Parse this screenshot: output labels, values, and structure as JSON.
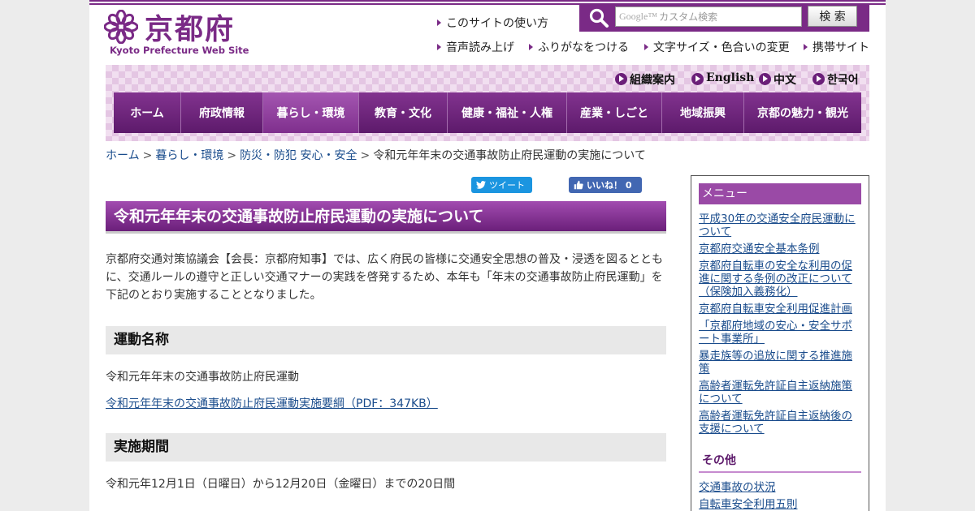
{
  "header": {
    "logo_name": "京都府",
    "logo_sub": "Kyoto Prefecture Web Site",
    "search_placeholder": "カスタム検索",
    "search_google": "Google™",
    "search_button": "検 索",
    "util_links": [
      "このサイトの使い方",
      "音声読み上げ",
      "ふりがなをつける",
      "文字サイズ・色合いの変更",
      "携帯サイト"
    ]
  },
  "languages": [
    "組織案内",
    "English",
    "中文",
    "한국어"
  ],
  "global_nav": {
    "items": [
      "ホーム",
      "府政情報",
      "暮らし・環境",
      "教育・文化",
      "健康・福祉・人権",
      "産業・しごと",
      "地域振興",
      "京都の魅力・観光"
    ],
    "active_index": 2
  },
  "breadcrumb": {
    "items": [
      "ホーム",
      "暮らし・環境",
      "防災・防犯 安心・安全"
    ],
    "current": "令和元年年末の交通事故防止府民運動の実施について",
    "separator": ">"
  },
  "social": {
    "tweet": "ツイート",
    "like": "いいね！ 0"
  },
  "main": {
    "title": "令和元年年末の交通事故防止府民運動の実施について",
    "intro": "京都府交通対策協議会【会長：京都府知事】では、広く府民の皆様に交通安全思想の普及・浸透を図るとともに、交通ルールの遵守と正しい交通マナーの実践を啓発するため、本年も「年末の交通事故防止府民運動」を下記のとおり実施することとなりました。",
    "sections": [
      {
        "heading": "運動名称",
        "text": "令和元年年末の交通事故防止府民運動",
        "link": "令和元年年末の交通事故防止府民運動実施要綱（PDF：347KB）"
      },
      {
        "heading": "実施期間",
        "text": "令和元年12月1日（日曜日）から12月20日（金曜日）までの20日間"
      }
    ]
  },
  "side_menu": {
    "head": "メニュー",
    "links": [
      "平成30年の交通安全府民運動について",
      "京都府交通安全基本条例",
      "京都府自転車の安全な利用の促進に関する条例の改正について（保険加入義務化）",
      "京都府自転車安全利用促進計画",
      "「京都府地域の安心・安全サポート事業所」",
      "暴走族等の追放に関する推進施策",
      "高齢者運転免許証自主返納施策について",
      "高齢者運転免許証自主返納後の支援について"
    ],
    "other_head": "その他",
    "other_links": [
      "交通事故の状況",
      "自転車安全利用五則"
    ]
  },
  "colors": {
    "brand_purple": "#7a2a86",
    "nav_dark": "#5d1a6b",
    "link": "#1a4c8c"
  },
  "icons": [
    "kyoto-emblem-icon",
    "search-icon",
    "triangle-bullet-icon",
    "circle-arrow-icon",
    "twitter-bird-icon",
    "thumbs-up-icon"
  ]
}
